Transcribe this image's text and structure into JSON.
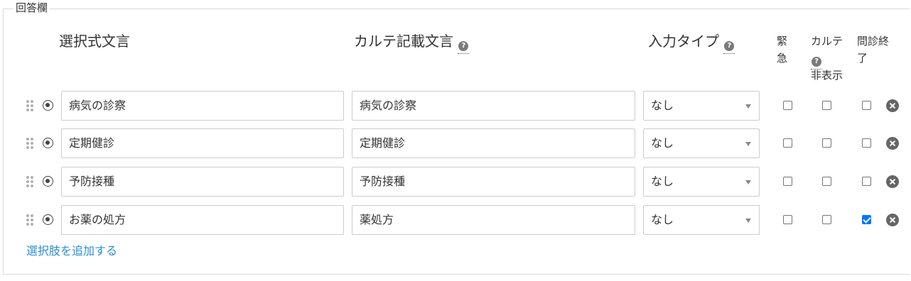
{
  "fieldset": {
    "legend": "回答欄"
  },
  "headers": {
    "choice_text": "選択式文言",
    "chart_text": "カルテ記載文言",
    "input_type": "入力タイプ",
    "urgent_line1": "緊",
    "urgent_line2": "急",
    "chart_hidden_line1": "カルテ",
    "chart_hidden_line2": "非表示",
    "end_interview_line1": "問診終",
    "end_interview_line2": "了",
    "help_glyph": "?"
  },
  "rows": [
    {
      "choice": "病気の診察",
      "chart": "病気の診察",
      "input_type": "なし",
      "urgent": false,
      "chart_hidden": false,
      "end_interview": false
    },
    {
      "choice": "定期健診",
      "chart": "定期健診",
      "input_type": "なし",
      "urgent": false,
      "chart_hidden": false,
      "end_interview": false
    },
    {
      "choice": "予防接種",
      "chart": "予防接種",
      "input_type": "なし",
      "urgent": false,
      "chart_hidden": false,
      "end_interview": false
    },
    {
      "choice": "お薬の処方",
      "chart": "薬処方",
      "input_type": "なし",
      "urgent": false,
      "chart_hidden": false,
      "end_interview": true
    }
  ],
  "add_option_label": "選択肢を追加する",
  "colors": {
    "link": "#2a8fd0",
    "checkbox_checked": "#0075ff",
    "border": "#cccccc",
    "delete_icon": "#666666"
  },
  "icons": {
    "drag": "drag-handle-icon",
    "radio": "radio-selected-icon",
    "help": "help-circle-icon",
    "caret": "chevron-down-icon",
    "delete": "remove-circle-icon"
  }
}
